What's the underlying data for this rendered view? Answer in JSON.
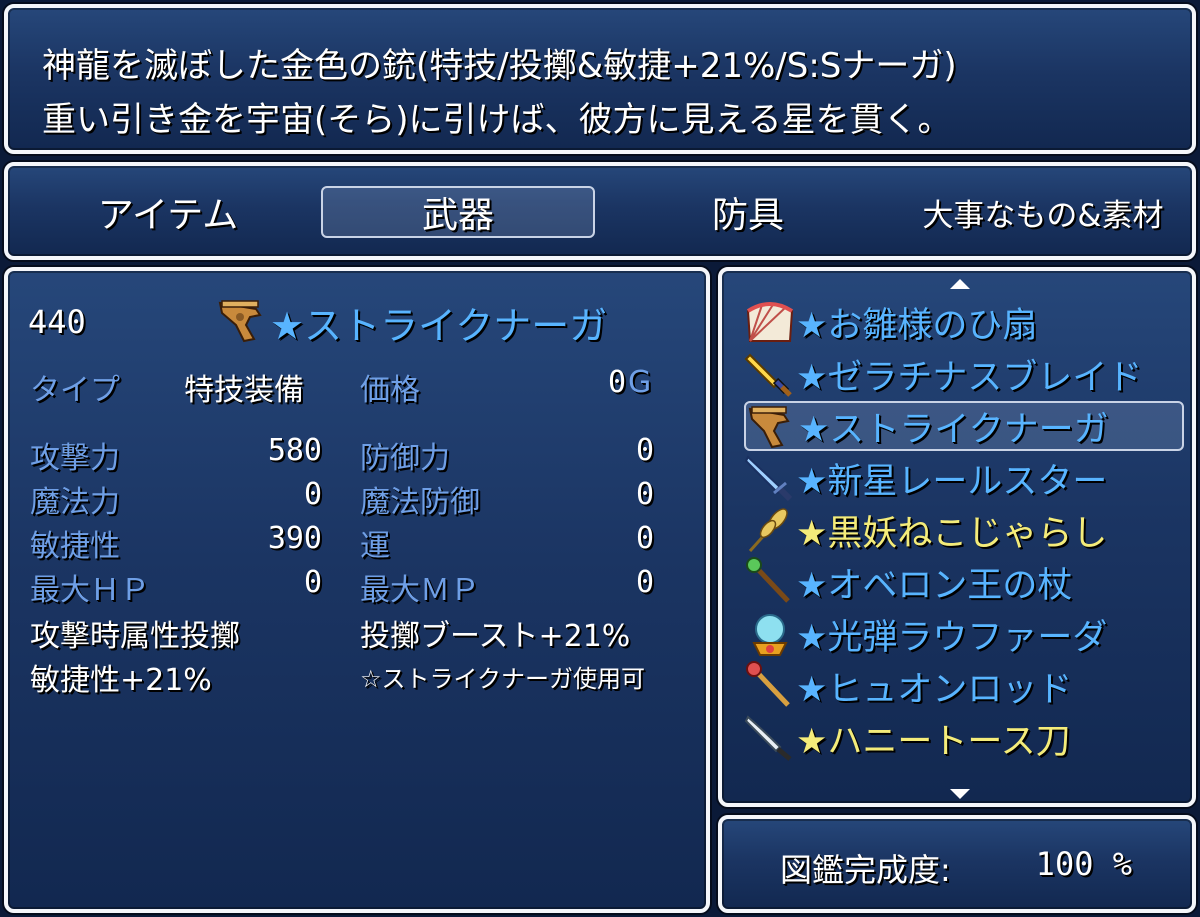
{
  "help": {
    "line1": "神龍を滅ぼした金色の銃(特技/投擲&敏捷+21%/S:Sナーガ)",
    "line2": "重い引き金を宇宙(そら)に引けば、彼方に見える星を貫く。"
  },
  "tabs": [
    {
      "label": "アイテム",
      "selected": false
    },
    {
      "label": "武器",
      "selected": true
    },
    {
      "label": "防具",
      "selected": false
    },
    {
      "label": "大事なもの&素材",
      "selected": false
    }
  ],
  "detail": {
    "item_no": "440",
    "item_name": "★ストライクナーガ",
    "item_icon": "revolver-gun-icon",
    "type_label": "タイプ",
    "type_value": "特技装備",
    "price_label": "価格",
    "price_value": "0",
    "price_unit": "G",
    "stats": [
      {
        "left_label": "攻撃力",
        "left_value": "580",
        "right_label": "防御力",
        "right_value": "0"
      },
      {
        "left_label": "魔法力",
        "left_value": "0",
        "right_label": "魔法防御",
        "right_value": "0"
      },
      {
        "left_label": "敏捷性",
        "left_value": "390",
        "right_label": "運",
        "right_value": "0"
      },
      {
        "left_label": "最大ＨＰ",
        "left_value": "0",
        "right_label": "最大ＭＰ",
        "right_value": "0"
      }
    ],
    "effects": [
      {
        "left": "攻撃時属性投擲",
        "right": "投擲ブースト+21%"
      },
      {
        "left": "敏捷性+21%",
        "right": "☆ストライクナーガ使用可"
      }
    ]
  },
  "weapon_list": [
    {
      "name": "★お雛様のひ扇",
      "icon": "folding-fan-icon",
      "color": "#58b4ff",
      "selected": false
    },
    {
      "name": "★ゼラチナスブレイド",
      "icon": "golden-sword-icon",
      "color": "#58b4ff",
      "selected": false
    },
    {
      "name": "★ストライクナーガ",
      "icon": "revolver-gun-icon",
      "color": "#58b4ff",
      "selected": true
    },
    {
      "name": "★新星レールスター",
      "icon": "blue-blade-icon",
      "color": "#58b4ff",
      "selected": false
    },
    {
      "name": "★黒妖ねこじゃらし",
      "icon": "wheat-stalk-icon",
      "color": "#f4ec7a",
      "selected": false
    },
    {
      "name": "★オベロン王の杖",
      "icon": "green-staff-icon",
      "color": "#58b4ff",
      "selected": false
    },
    {
      "name": "★光弾ラウファーダ",
      "icon": "crystal-orb-icon",
      "color": "#58b4ff",
      "selected": false
    },
    {
      "name": "★ヒュオンロッド",
      "icon": "rod-icon",
      "color": "#58b4ff",
      "selected": false
    },
    {
      "name": "★ハニートース刀",
      "icon": "katana-icon",
      "color": "#f4ec7a",
      "selected": false
    }
  ],
  "completion": {
    "label": "図鑑完成度:",
    "value": "100 %"
  },
  "colors": {
    "label_blue": "#6f9fe6",
    "rare_blue": "#58b4ff",
    "rare_gold": "#f4ec7a"
  }
}
